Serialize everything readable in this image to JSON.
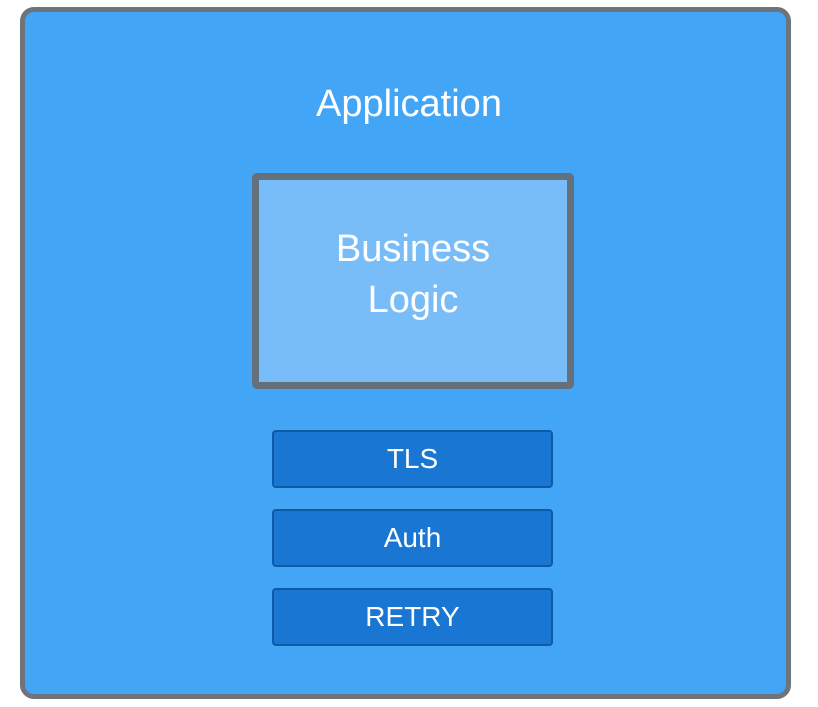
{
  "application": {
    "title": "Application"
  },
  "business_logic": {
    "label": "Business Logic"
  },
  "layers": [
    {
      "label": "TLS"
    },
    {
      "label": "Auth"
    },
    {
      "label": "RETRY"
    }
  ],
  "colors": {
    "application_fill": "#42a5f5",
    "application_border": "#6e747c",
    "logic_fill": "#78bdf8",
    "logic_border": "#64707c",
    "layer_fill": "#1976d2",
    "layer_border": "#0f5aa5",
    "text": "#ffffff"
  }
}
